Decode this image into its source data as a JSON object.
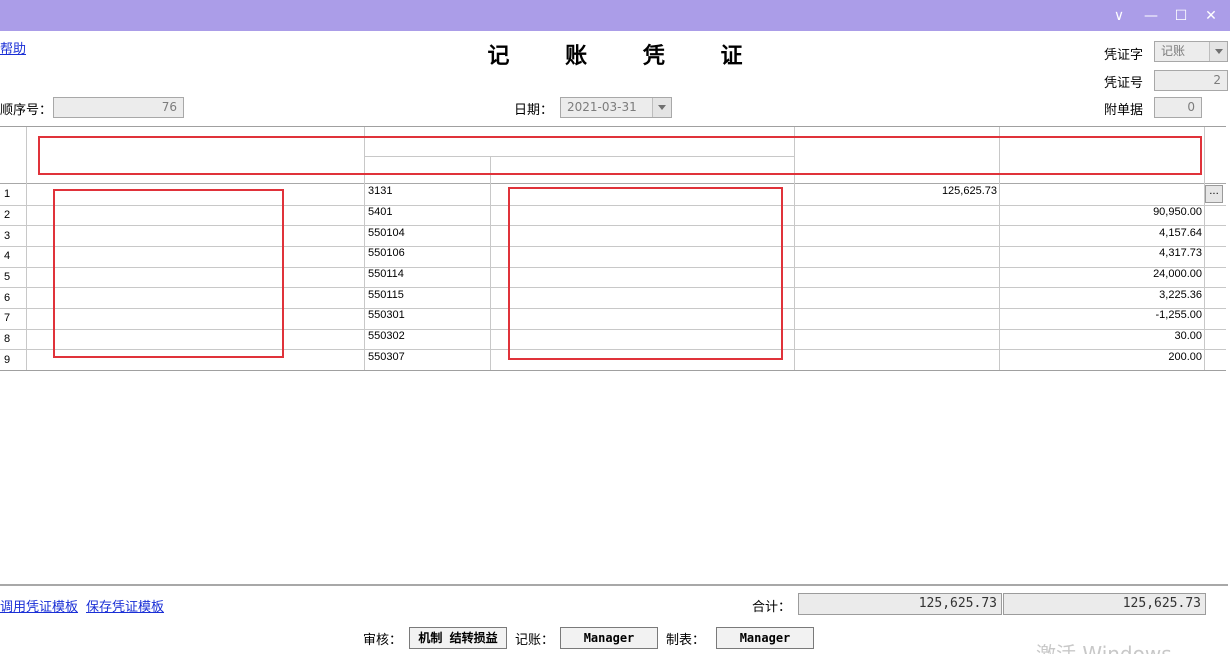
{
  "window": {
    "controls": {
      "dropdown": "∨",
      "minimize": "—",
      "maximize": "☐",
      "close": "✕"
    }
  },
  "header": {
    "help_link": "帮助",
    "title": "记 账 凭 证",
    "voucher_type_label": "凭证字",
    "voucher_type_value": "记账",
    "voucher_no_label": "凭证号",
    "voucher_no_value": "2",
    "seq_label": "顺序号：",
    "seq_value": "76",
    "date_label": "日期：",
    "date_value": "2021-03-31",
    "attachments_label": "附单据",
    "attachments_value": "0"
  },
  "table": {
    "rows": [
      {
        "no": "1",
        "account": "3131",
        "debit": "125,625.73",
        "credit": ""
      },
      {
        "no": "2",
        "account": "5401",
        "debit": "",
        "credit": "90,950.00"
      },
      {
        "no": "3",
        "account": "550104",
        "debit": "",
        "credit": "4,157.64"
      },
      {
        "no": "4",
        "account": "550106",
        "debit": "",
        "credit": "4,317.73"
      },
      {
        "no": "5",
        "account": "550114",
        "debit": "",
        "credit": "24,000.00"
      },
      {
        "no": "6",
        "account": "550115",
        "debit": "",
        "credit": "3,225.36"
      },
      {
        "no": "7",
        "account": "550301",
        "debit": "",
        "credit": "-1,255.00"
      },
      {
        "no": "8",
        "account": "550302",
        "debit": "",
        "credit": "30.00"
      },
      {
        "no": "9",
        "account": "550307",
        "debit": "",
        "credit": "200.00"
      }
    ],
    "ellipsis_label": "..."
  },
  "footer": {
    "load_template_link": "调用凭证模板",
    "save_template_link": "保存凭证模板",
    "total_label": "合计：",
    "total_debit": "125,625.73",
    "total_credit": "125,625.73",
    "audit_label": "审核：",
    "audit_value": "机制 结转损益",
    "posting_label": "记账：",
    "posting_value": "Manager",
    "preparer_label": "制表：",
    "preparer_value": "Manager"
  },
  "watermark": "激活 Windows",
  "colors": {
    "titlebar": "#ab9de8",
    "highlight_border": "#e0323a",
    "link": "#1a2fd6"
  }
}
